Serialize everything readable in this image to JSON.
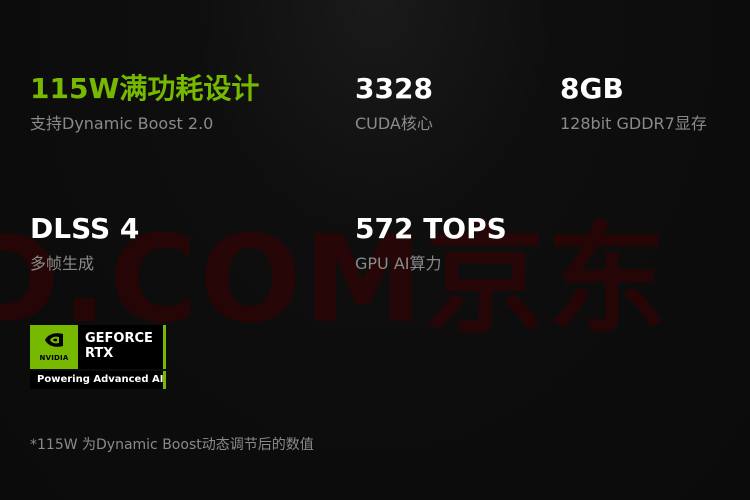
{
  "watermark": "D.COM京东",
  "specs": [
    {
      "value": "115W满功耗设计",
      "label": "支持Dynamic Boost 2.0"
    },
    {
      "value": "3328",
      "label": "CUDA核心"
    },
    {
      "value": "8GB",
      "label": "128bit GDDR7显存"
    },
    {
      "value": "DLSS 4",
      "label": "多帧生成"
    },
    {
      "value": "572 TOPS",
      "label": "GPU AI算力"
    }
  ],
  "badge": {
    "logo_text": "NVIDIA",
    "brand_line1": "GEFORCE",
    "brand_line2": "RTX",
    "tagline": "Powering Advanced AI"
  },
  "footnote": "*115W 为Dynamic Boost动态调节后的数值",
  "colors": {
    "accent": "#76b900",
    "background": "#0c0c0c",
    "text_primary": "#ffffff",
    "text_secondary": "#8a8a8a",
    "watermark": "#3a0000"
  }
}
